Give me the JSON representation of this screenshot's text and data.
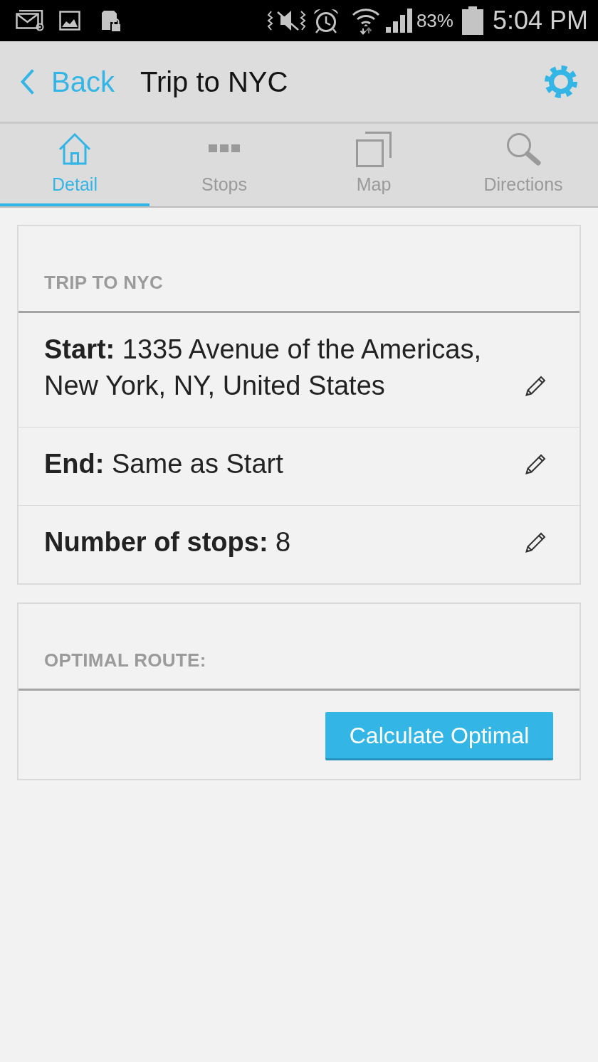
{
  "status_bar": {
    "battery": "83%",
    "time": "5:04 PM"
  },
  "app_bar": {
    "back": "Back",
    "title": "Trip to NYC"
  },
  "tabs": [
    {
      "label": "Detail",
      "selected": true
    },
    {
      "label": "Stops",
      "selected": false
    },
    {
      "label": "Map",
      "selected": false
    },
    {
      "label": "Directions",
      "selected": false
    }
  ],
  "trip_card": {
    "header": "TRIP TO NYC",
    "rows": [
      {
        "text": "**Start:** 1335 Avenue of the Americas, New York, NY, United States"
      },
      {
        "text": "**End:** Same as Start"
      },
      {
        "text": "**Number of stops:** 8"
      }
    ]
  },
  "route_card": {
    "header": "OPTIMAL ROUTE:",
    "button": "Calculate Optimal"
  }
}
